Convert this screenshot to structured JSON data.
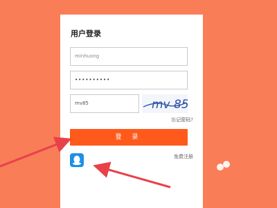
{
  "login": {
    "title": "用户登录",
    "username_value": "minhuong",
    "password_value": "••••••••••",
    "captcha_input_value": "mv85",
    "captcha_image_text": "mv 85",
    "forgot_password": "忘记密码?",
    "login_button": "登 录",
    "register_link": "免费注册",
    "qq_login_icon": "qq-icon"
  },
  "colors": {
    "background": "#f97d57",
    "button": "#ff5a1c",
    "qq": "#1e8fe8",
    "arrow": "#e8414a"
  }
}
